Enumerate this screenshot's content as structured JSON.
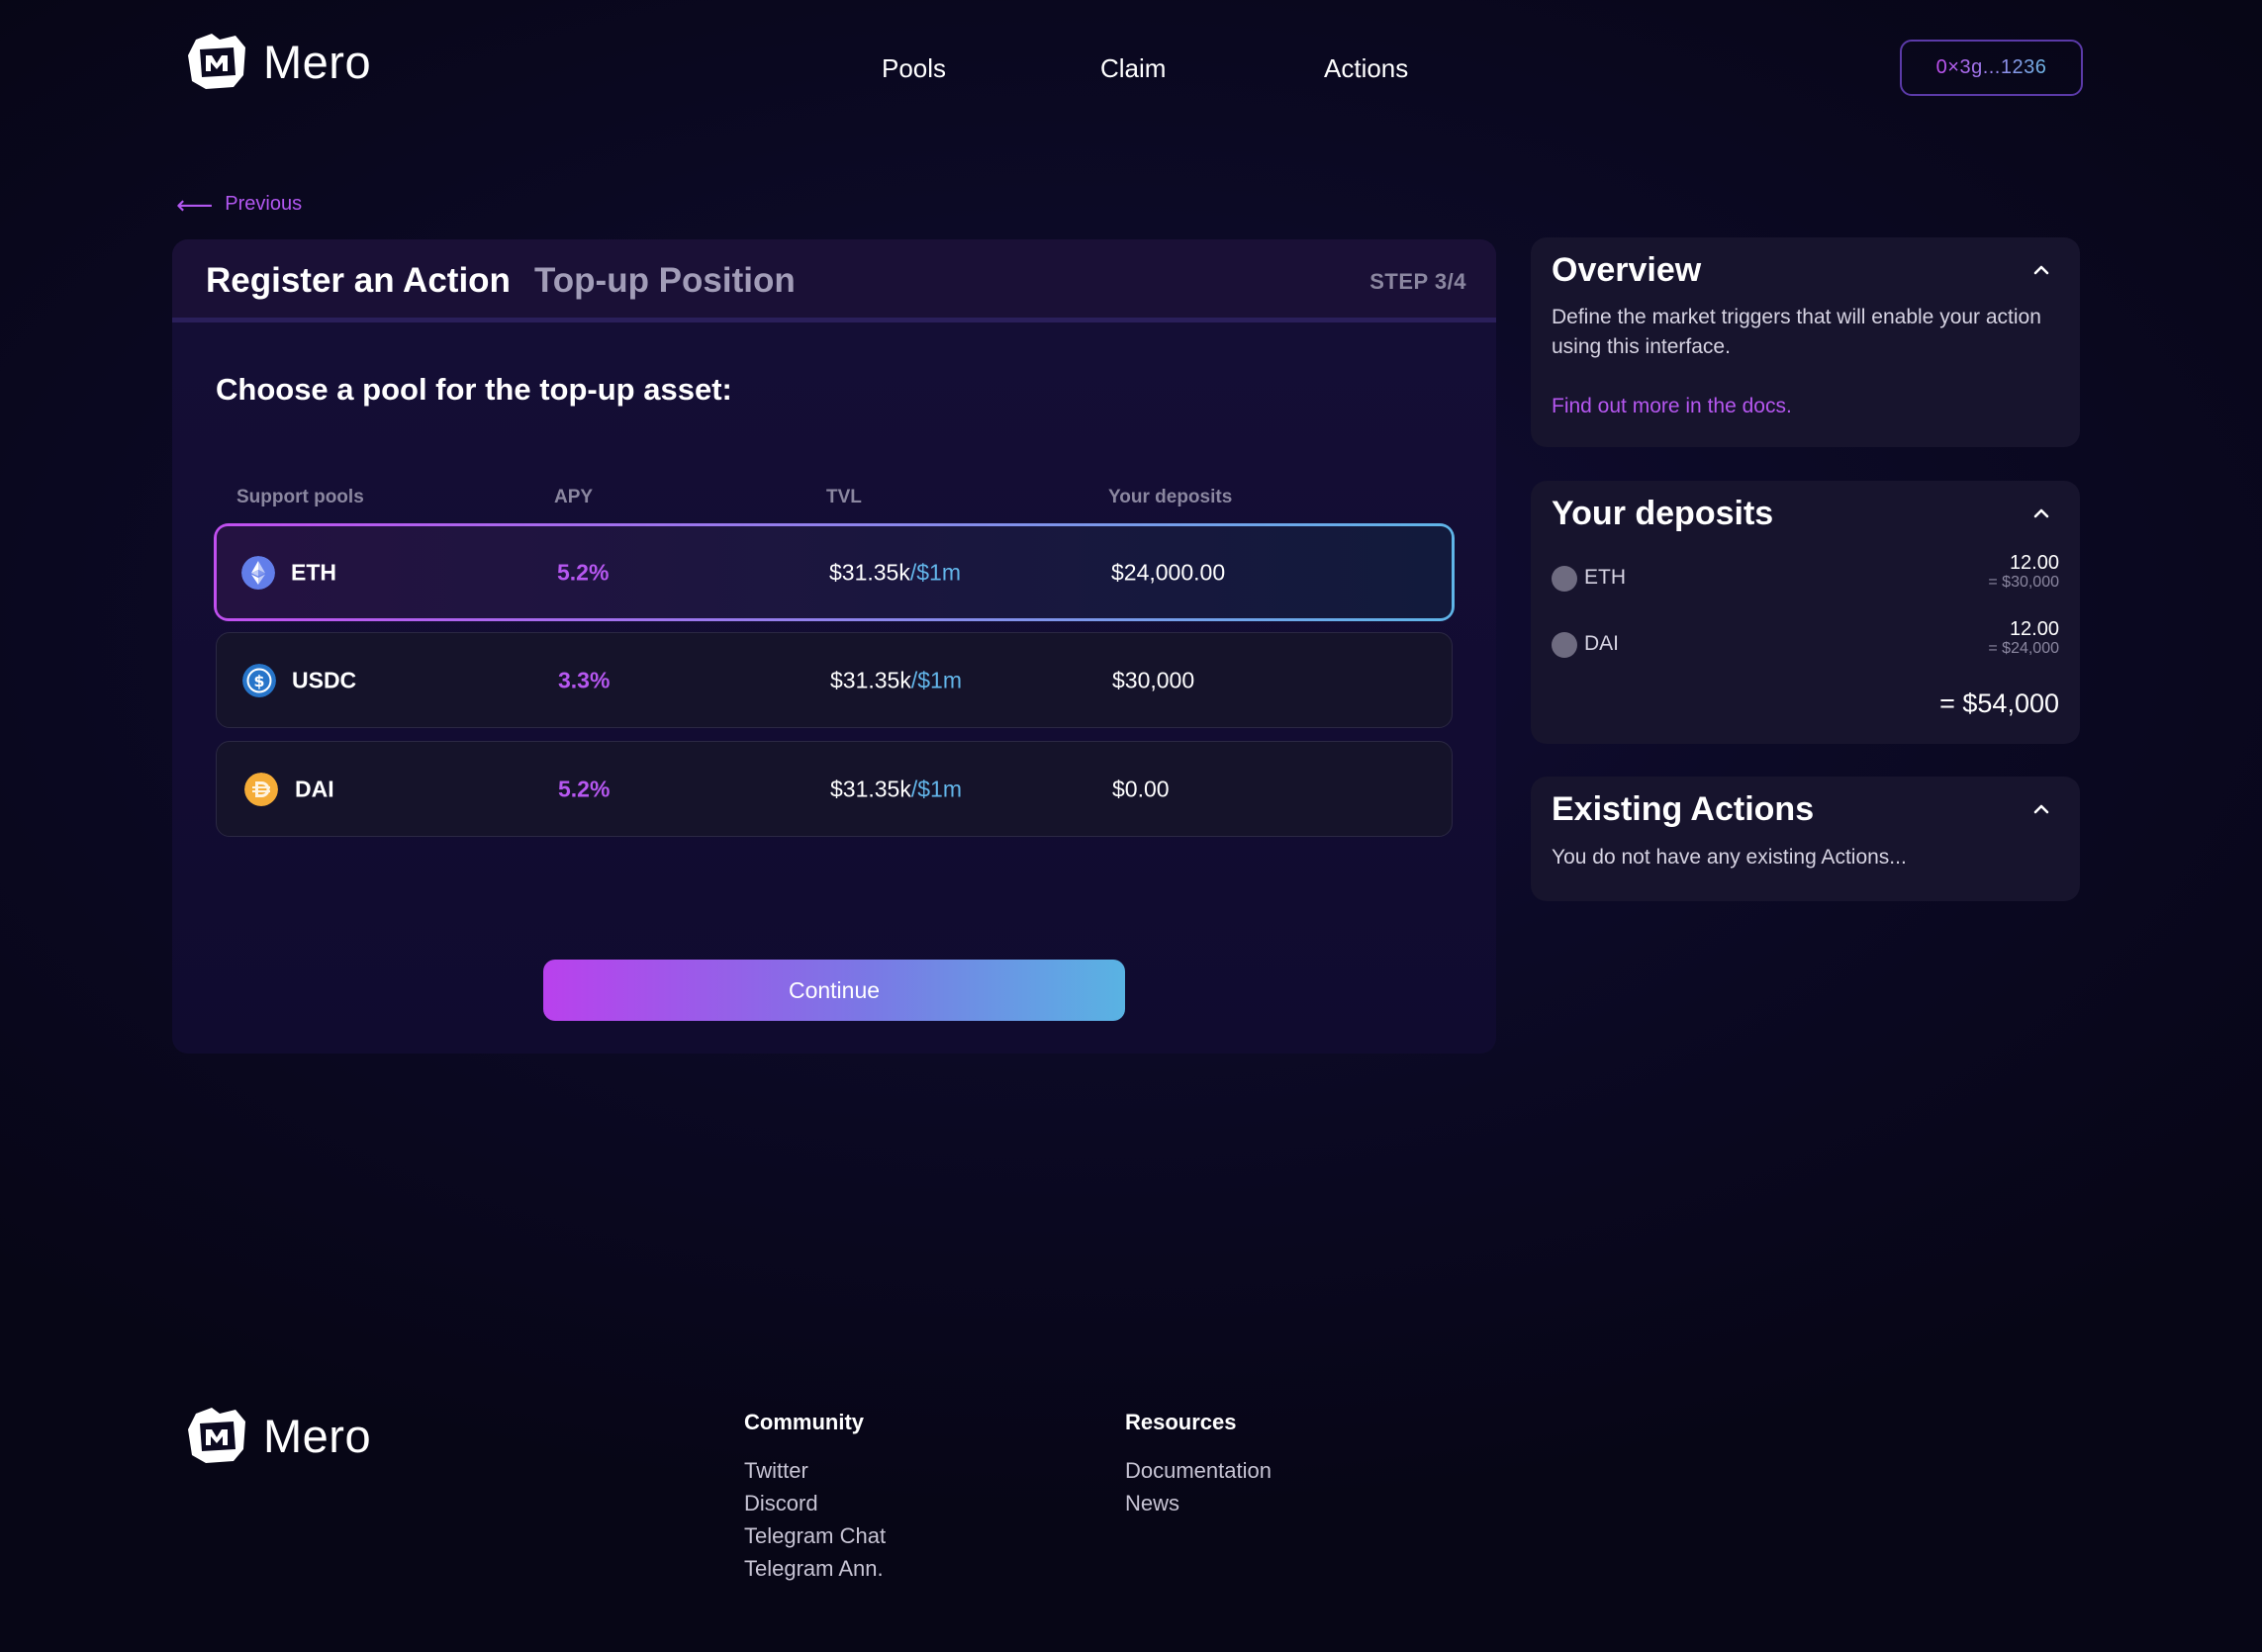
{
  "header": {
    "brand": "Mero",
    "nav": [
      "Pools",
      "Claim",
      "Actions"
    ],
    "wallet": "0×3g...1236"
  },
  "back": {
    "label": "Previous"
  },
  "card": {
    "title": "Register an Action",
    "subtitle": "Top-up Position",
    "step": "STEP 3/4",
    "prompt": "Choose a pool for the top-up asset:",
    "columns": [
      "Support pools",
      "APY",
      "TVL",
      "Your deposits"
    ],
    "rows": [
      {
        "symbol": "ETH",
        "icon": "eth-icon",
        "apy": "5.2%",
        "tvl": "$31.35k",
        "tvl_cap": "/$1m",
        "deposit": "$24,000.00",
        "selected": true
      },
      {
        "symbol": "USDC",
        "icon": "usdc-icon",
        "apy": "3.3%",
        "tvl": "$31.35k",
        "tvl_cap": "/$1m",
        "deposit": "$30,000",
        "selected": false
      },
      {
        "symbol": "DAI",
        "icon": "dai-icon",
        "apy": "5.2%",
        "tvl": "$31.35k",
        "tvl_cap": "/$1m",
        "deposit": "$0.00",
        "selected": false
      }
    ],
    "continue_label": "Continue"
  },
  "overview": {
    "title": "Overview",
    "text": "Define the market triggers that will enable your action using this interface.",
    "link": "Find out more in the docs."
  },
  "deposits": {
    "title": "Your deposits",
    "items": [
      {
        "name": "ETH",
        "amount": "12.00",
        "usd": "= $30,000"
      },
      {
        "name": "DAI",
        "amount": "12.00",
        "usd": "= $24,000"
      }
    ],
    "total": "= $54,000"
  },
  "existing": {
    "title": "Existing Actions",
    "text": "You do not have any existing Actions..."
  },
  "footer": {
    "brand": "Mero",
    "community": {
      "title": "Community",
      "links": [
        "Twitter",
        "Discord",
        "Telegram Chat",
        "Telegram Ann."
      ]
    },
    "resources": {
      "title": "Resources",
      "links": [
        "Documentation",
        "News"
      ]
    }
  },
  "colors": {
    "background": "#0b0920",
    "accent_purple": "#b657f0",
    "accent_blue": "#63b6ea",
    "eth": "#627eea",
    "usdc": "#2775ca",
    "dai": "#f5ac37"
  }
}
